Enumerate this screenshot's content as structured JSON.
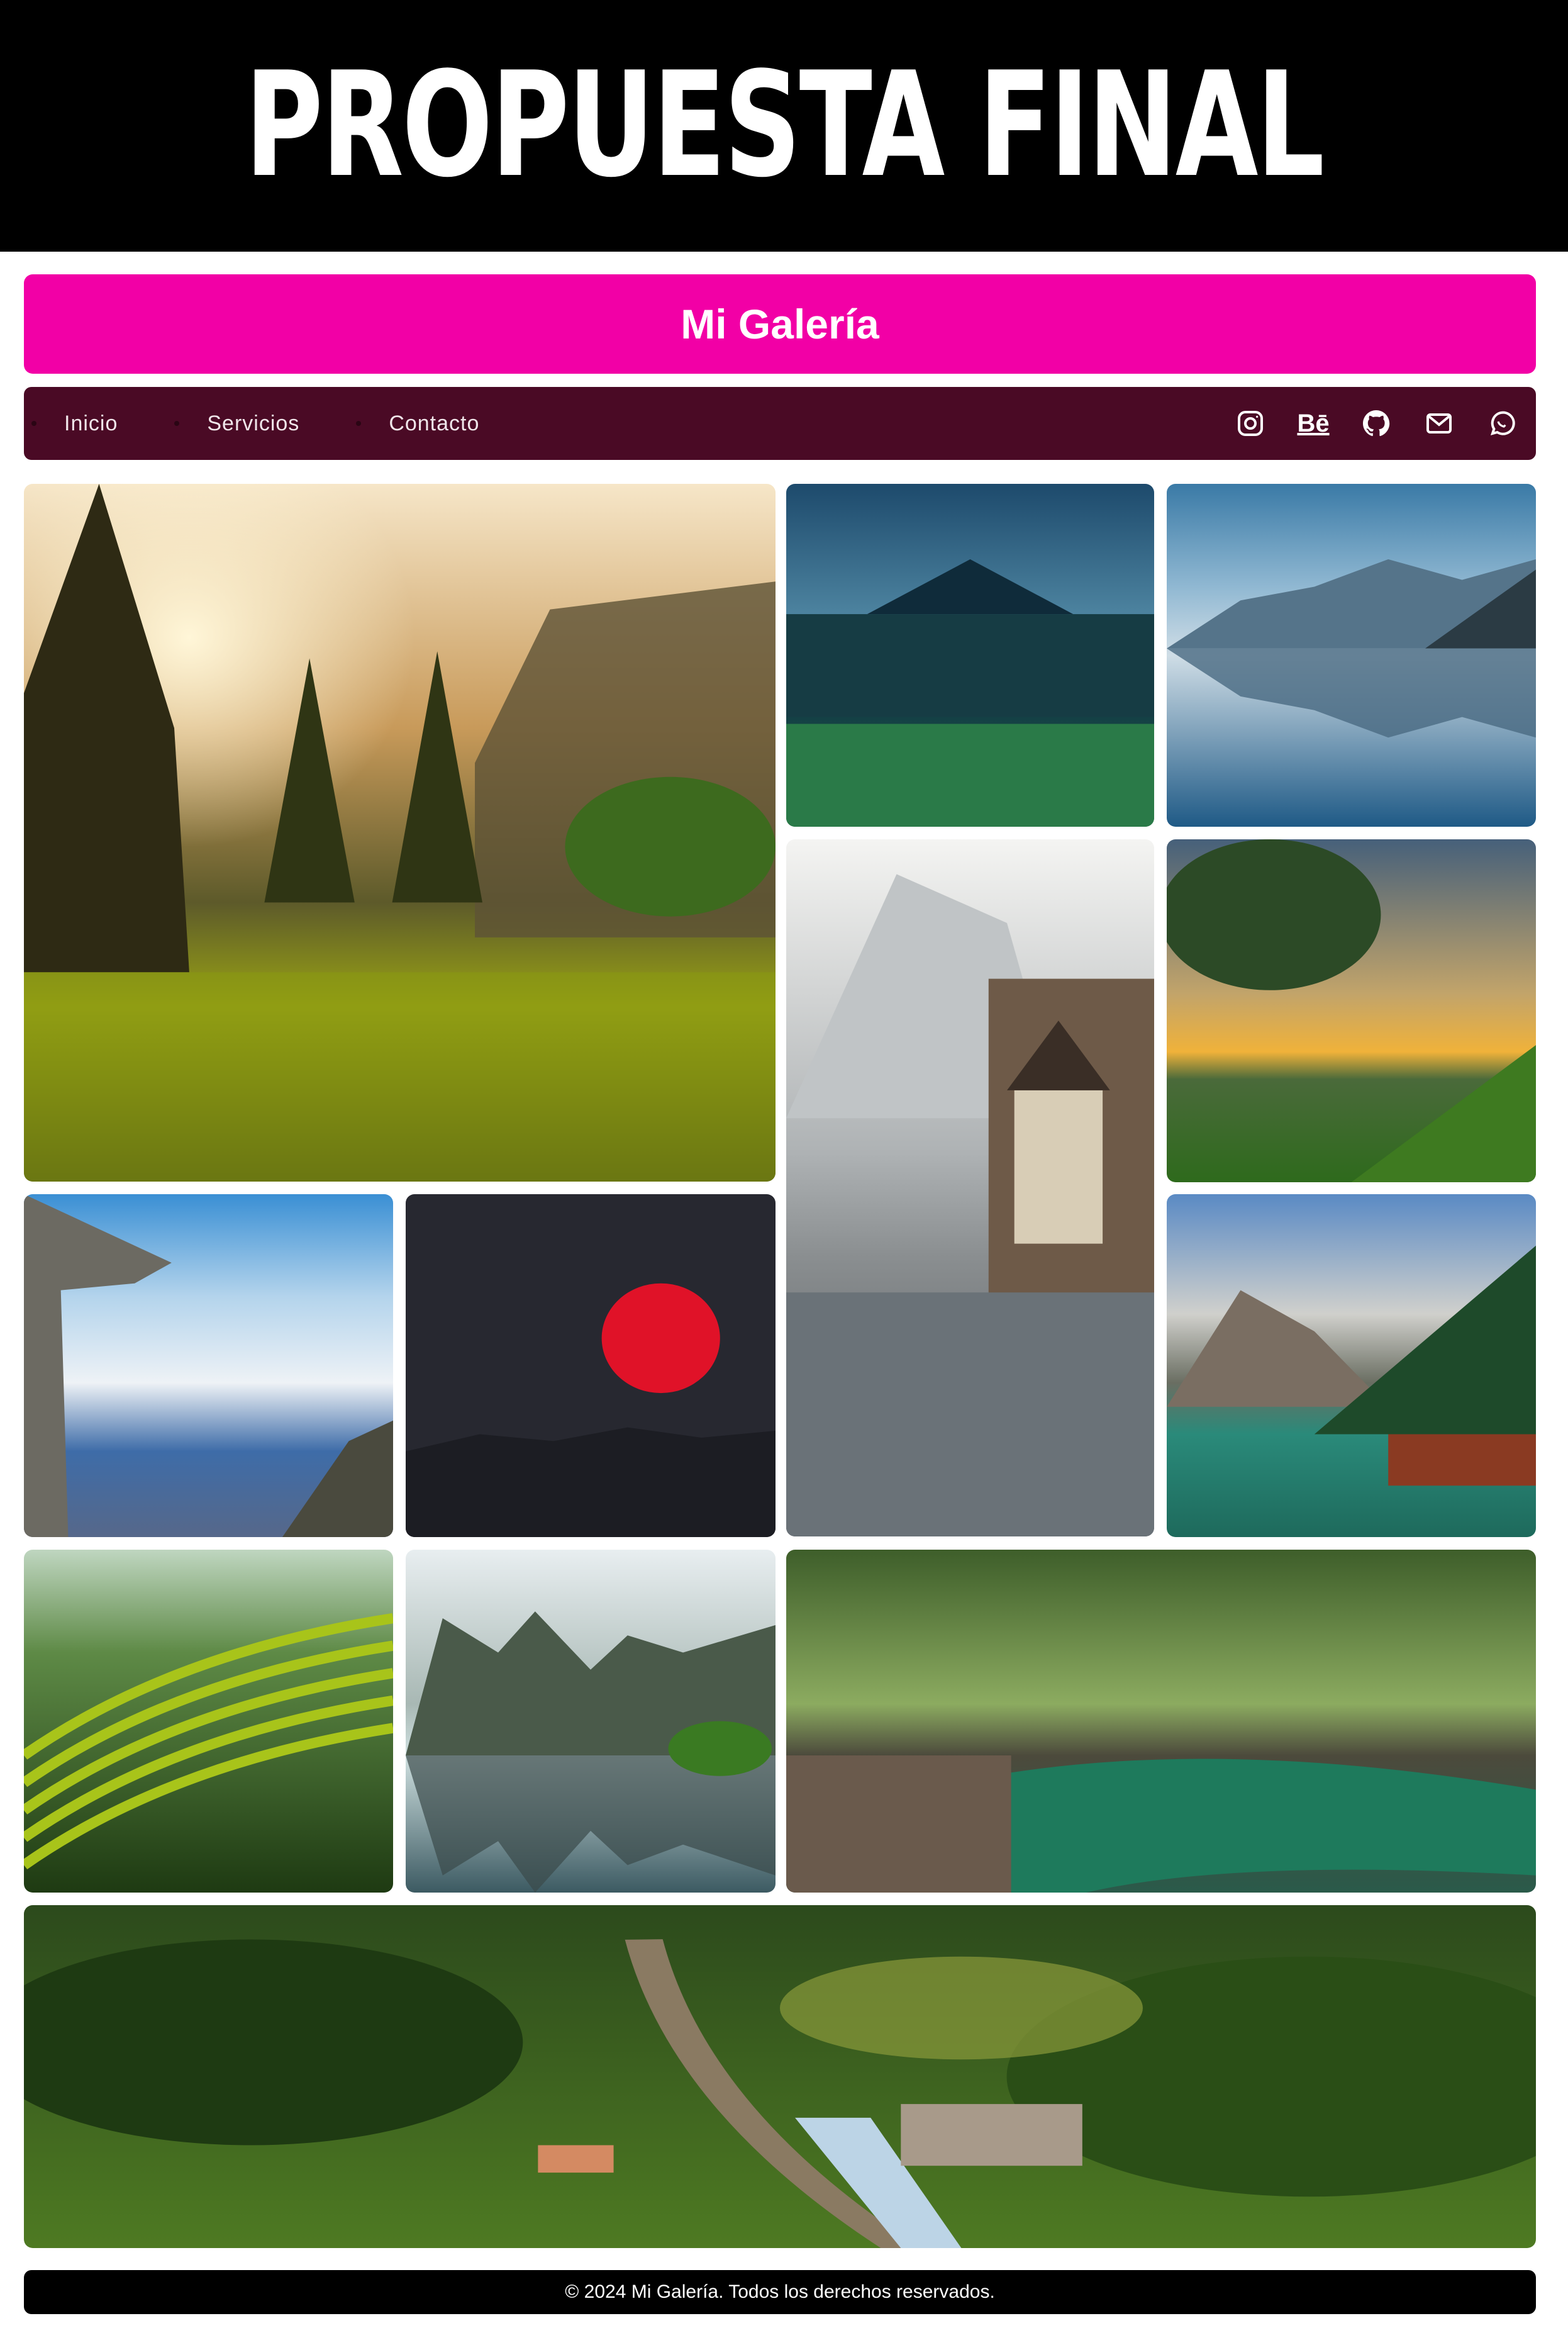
{
  "banner": {
    "title": "PROPUESTA FINAL"
  },
  "header": {
    "title": "Mi Galería"
  },
  "nav": {
    "links": [
      "Inicio",
      "Servicios",
      "Contacto"
    ],
    "icons": [
      "instagram-icon",
      "behance-icon",
      "github-icon",
      "mail-icon",
      "whatsapp-icon"
    ],
    "behance_label": "Bē"
  },
  "gallery": {
    "images": [
      "forest-sunrise-valley",
      "volcano-blue-lake",
      "mountain-lake-reflection",
      "alpine-village-lakeside",
      "tree-sunset-meadow",
      "cliff-over-clouds",
      "red-sun-dark-sky",
      "mountain-lake-boathouse",
      "rice-terraces",
      "karst-river-boat",
      "forest-river",
      "train-through-jungle"
    ]
  },
  "footer": {
    "text": "© 2024 Mi Galería. Todos los derechos reservados."
  },
  "colors": {
    "banner": "#000000",
    "header": "#f200a6",
    "nav": "#4a0a25",
    "footer": "#000000"
  }
}
